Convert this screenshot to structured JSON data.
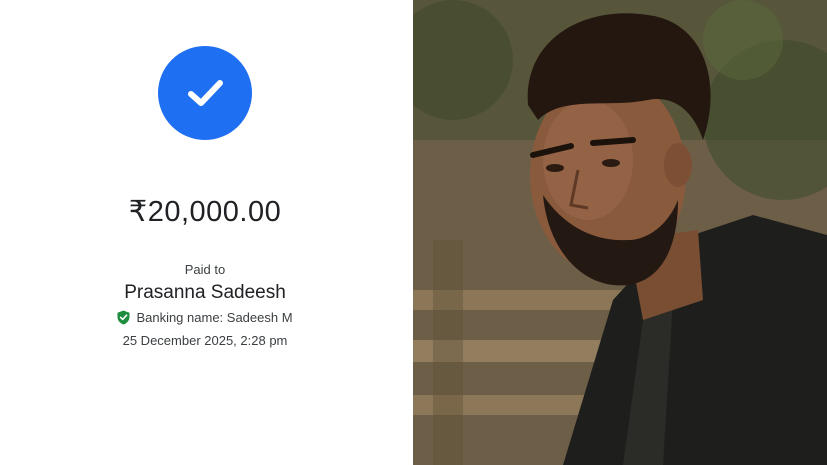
{
  "payment": {
    "amount": "₹20,000.00",
    "paid_to_label": "Paid to",
    "payee_name": "Prasanna Sadeesh",
    "banking_name": "Banking name: Sadeesh  M",
    "datetime": "25 December 2025, 2:28 pm"
  },
  "icons": {
    "success": "check-icon",
    "verified": "shield-check-icon"
  },
  "colors": {
    "accent_blue": "#1f6ff2",
    "verified_green": "#1e8e3e",
    "text_primary": "#202124",
    "text_secondary": "#3c4043"
  }
}
